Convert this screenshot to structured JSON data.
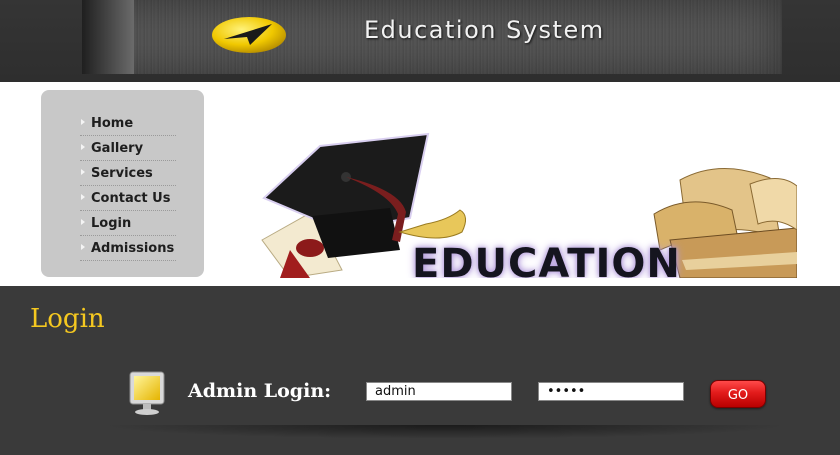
{
  "header": {
    "site_title": "Education System",
    "logo_icon": "yellow-pointer-logo-icon"
  },
  "sidebar": {
    "items": [
      {
        "label": "Home"
      },
      {
        "label": "Gallery"
      },
      {
        "label": "Services"
      },
      {
        "label": "Contact Us"
      },
      {
        "label": "Login"
      },
      {
        "label": "Admissions"
      }
    ]
  },
  "banner": {
    "text": "EDUCATION",
    "icons": [
      "graduation-cap-icon",
      "diploma-scroll-icon",
      "books-stack-icon"
    ]
  },
  "login": {
    "title": "Login",
    "admin_label": "Admin Login:",
    "username_value": "admin",
    "password_value": "•••••",
    "go_label": "GO",
    "monitor_icon": "monitor-icon"
  },
  "colors": {
    "accent_yellow": "#f5c820",
    "go_red": "#e21b1b",
    "page_bg": "#3a3a3a",
    "sidebar_bg": "#c8c8c8"
  }
}
